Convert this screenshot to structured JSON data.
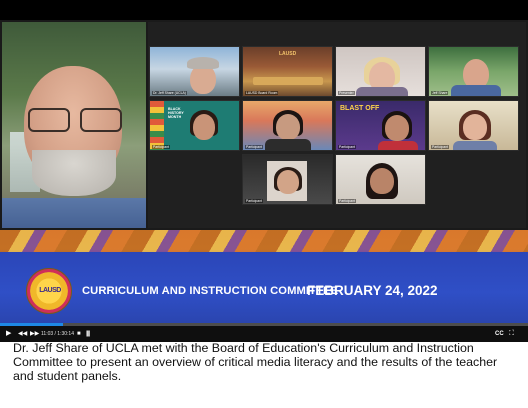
{
  "banner": {
    "committee": "CURRICULUM AND INSTRUCTION COMMITTEE",
    "date": "FEBRUARY 24, 2022",
    "seal_text": "LAUSD"
  },
  "gallery": {
    "tiles": [
      {
        "label": "Dr. Jeff Share (UCLA)"
      },
      {
        "label": "LAUSD Board Room"
      },
      {
        "label": "Presenter"
      },
      {
        "label": "Jeff Share"
      },
      {
        "label": "Participant"
      },
      {
        "label": "Participant"
      },
      {
        "label": "Participant"
      },
      {
        "label": "Participant"
      },
      {
        "label": "Participant"
      },
      {
        "label": "Participant"
      }
    ],
    "tile_texts": {
      "black_history": "BLACK HISTORY MONTH",
      "blast_off": "BLAST OFF",
      "board_seal": "LAUSD"
    }
  },
  "player": {
    "time": "11:03 / 1:30:14",
    "progress_fraction": 0.12,
    "cc_label": "CC",
    "play_icon": "play-icon",
    "volume_icon": "volume-icon",
    "settings_icon": "gear-icon",
    "fullscreen_icon": "fullscreen-icon"
  },
  "caption": "Dr. Jeff Share of UCLA met with the Board of Education's Curriculum and Instruction Committee to present an overview of critical media literacy and the results of the teacher and student panels.",
  "colors": {
    "banner_blue": "#2f4fc6",
    "progress_blue": "#1e88e5",
    "banner_orange": "#e4a53a"
  }
}
